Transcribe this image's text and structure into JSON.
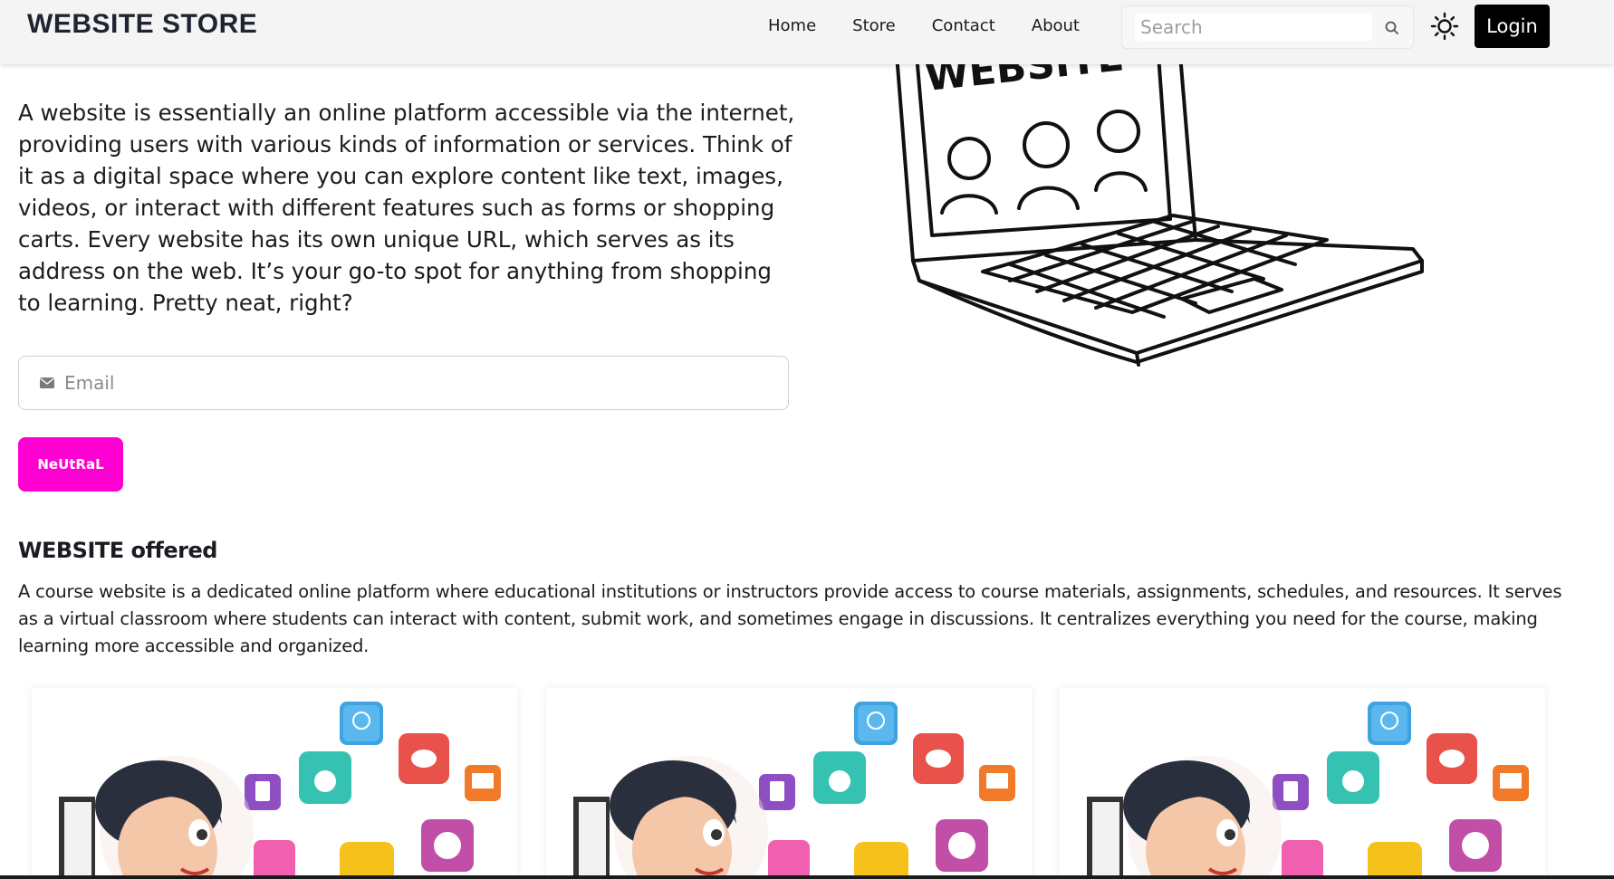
{
  "navbar": {
    "brand": "WEBSITE STORE",
    "links": [
      "Home",
      "Store",
      "Contact",
      "About"
    ],
    "search_placeholder": "Search",
    "login_label": "Login"
  },
  "hero": {
    "text": "A website is essentially an online platform accessible via the internet, providing users with various kinds of information or services. Think of it as a digital space where you can explore content like text, images, videos, or interact with different features such as forms or shopping carts. Every website has its own unique URL, which serves as its address on the web. It’s your go-to spot for anything from shopping to learning. Pretty neat, right?",
    "illustration_text": "WEBSITE",
    "email_placeholder": "Email",
    "neutral_button": "NeUtRaL"
  },
  "offered": {
    "title": "WEBSITE offered",
    "text": "A course website is a dedicated online platform where educational institutions or instructors provide access to course materials, assignments, schedules, and resources. It serves as a virtual classroom where students can interact with content, submit work, and sometimes engage in discussions. It centralizes everything you need for the course, making learning more accessible and organized."
  },
  "cards": [
    {
      "illustration": "student-with-education-icons"
    },
    {
      "illustration": "student-with-education-icons"
    },
    {
      "illustration": "student-with-education-icons"
    }
  ],
  "colors": {
    "accent": "#ff00d2",
    "login_bg": "#000000",
    "navbar_bg": "#f4f4f4"
  }
}
